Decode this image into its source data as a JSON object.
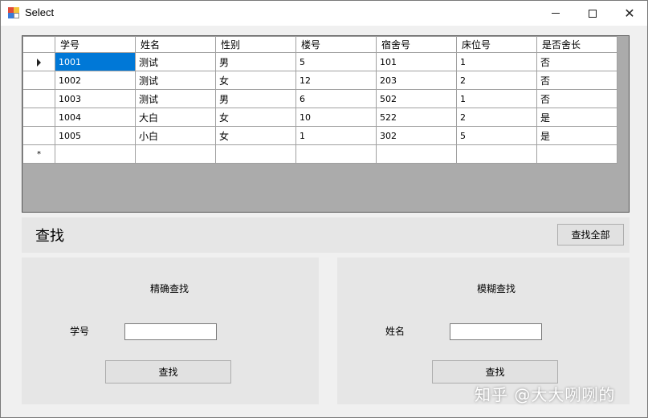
{
  "window": {
    "title": "Select"
  },
  "grid": {
    "columns": [
      "学号",
      "姓名",
      "性别",
      "楼号",
      "宿舍号",
      "床位号",
      "是否舍长"
    ],
    "rows": [
      [
        "1001",
        "测试",
        "男",
        "5",
        "101",
        "1",
        "否"
      ],
      [
        "1002",
        "测试",
        "女",
        "12",
        "203",
        "2",
        "否"
      ],
      [
        "1003",
        "测试",
        "男",
        "6",
        "502",
        "1",
        "否"
      ],
      [
        "1004",
        "大白",
        "女",
        "10",
        "522",
        "2",
        "是"
      ],
      [
        "1005",
        "小白",
        "女",
        "1",
        "302",
        "5",
        "是"
      ]
    ],
    "new_row_marker": "*"
  },
  "find_bar": {
    "label": "查找",
    "find_all_button": "查找全部"
  },
  "exact_search": {
    "title": "精确查找",
    "field_label": "学号",
    "field_value": "",
    "button": "查找"
  },
  "fuzzy_search": {
    "title": "模糊查找",
    "field_label": "姓名",
    "field_value": "",
    "button": "查找"
  },
  "watermark": "知乎 @大大咧咧的",
  "colors": {
    "selection": "#0078d7",
    "panel": "#e6e6e6",
    "grid_background": "#ababab"
  }
}
